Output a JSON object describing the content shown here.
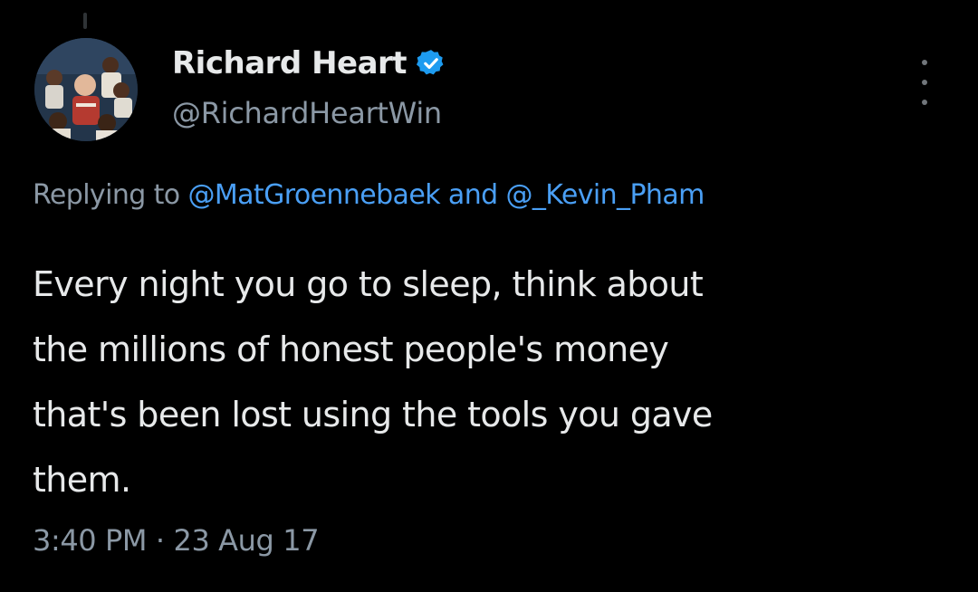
{
  "tweet": {
    "author": {
      "display_name": "Richard Heart",
      "handle": "@RichardHeartWin",
      "verified": true,
      "verified_icon": "verified-badge-icon"
    },
    "reply": {
      "prefix": "Replying to",
      "mention_1": "@MatGroennebaek",
      "conjunction": "and",
      "mention_2": "@_Kevin_Pham"
    },
    "text": "Every night you go to sleep, think about\nthe millions of honest people's money\nthat's been lost using the tools you gave\nthem.",
    "time": "3:40 PM",
    "separator": "·",
    "date": "23 Aug 17",
    "more_icon": "more-vertical-icon"
  },
  "colors": {
    "background": "#000000",
    "primary_text": "#e7e9ea",
    "secondary_text": "#8b98a5",
    "mention": "#4a9ff5",
    "verified": "#1d9bf0"
  }
}
